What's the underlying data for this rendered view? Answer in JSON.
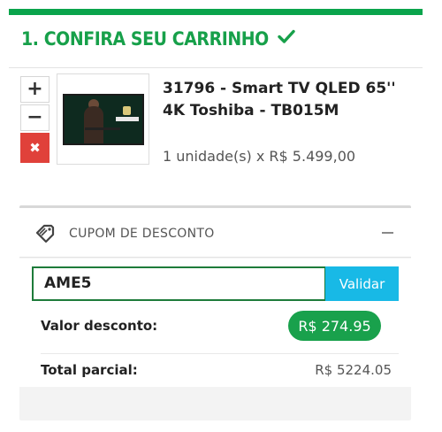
{
  "step": {
    "title": "1. CONFIRA SEU CARRINHO"
  },
  "cart_item": {
    "name": "31796 - Smart TV QLED 65'' 4K Toshiba - TB015M",
    "quantity_text": "1 unidade(s) x R$ 5.499,00",
    "increment_label": "+",
    "decrement_label": "−",
    "remove_label": "✖"
  },
  "coupon": {
    "header_label": "CUPOM DE DESCONTO",
    "input_value": "AME5",
    "validate_label": "Validar",
    "discount_label": "Valor desconto:",
    "discount_value": "R$ 274.95",
    "subtotal_label": "Total parcial:",
    "subtotal_value": "R$ 5224.05"
  },
  "colors": {
    "brand_green": "#17a04a",
    "remove_red": "#e0413a",
    "validate_blue": "#18b9e6"
  },
  "icons": {
    "step_status": "check-icon",
    "coupon": "tag-icon",
    "collapse": "minus-icon"
  }
}
